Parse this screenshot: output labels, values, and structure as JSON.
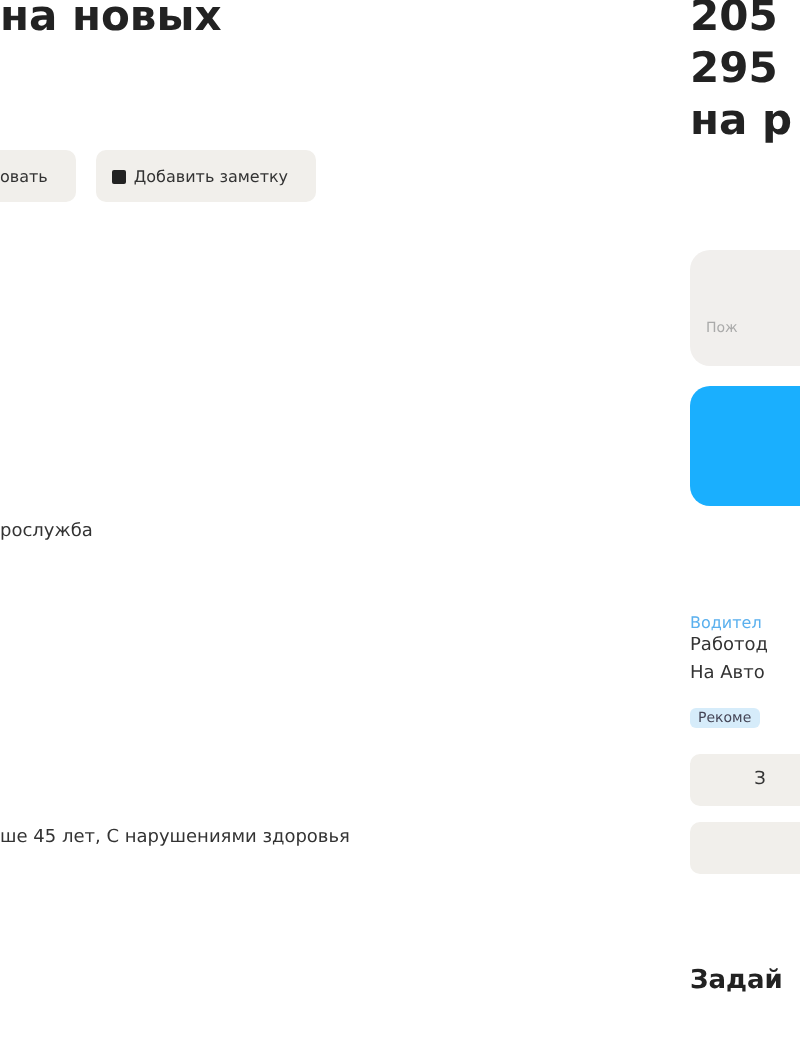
{
  "main": {
    "title": "на новых",
    "actions": [
      {
        "label": "овать",
        "icon": false
      },
      {
        "label": "Добавить заметку",
        "icon": true
      }
    ],
    "lines": [
      "рослужба",
      "ше 45 лет, С нарушениями здоровья"
    ]
  },
  "sidebar": {
    "salary": [
      "205",
      "295",
      "на р"
    ],
    "field": {
      "placeholder": "Пож"
    },
    "category": "Водител",
    "company": [
      "Работод",
      "На Авто"
    ],
    "tag": "Рекоме",
    "buttons": [
      {
        "kind": "text",
        "label": "З"
      },
      {
        "kind": "blank"
      }
    ],
    "heading": "Задай"
  }
}
